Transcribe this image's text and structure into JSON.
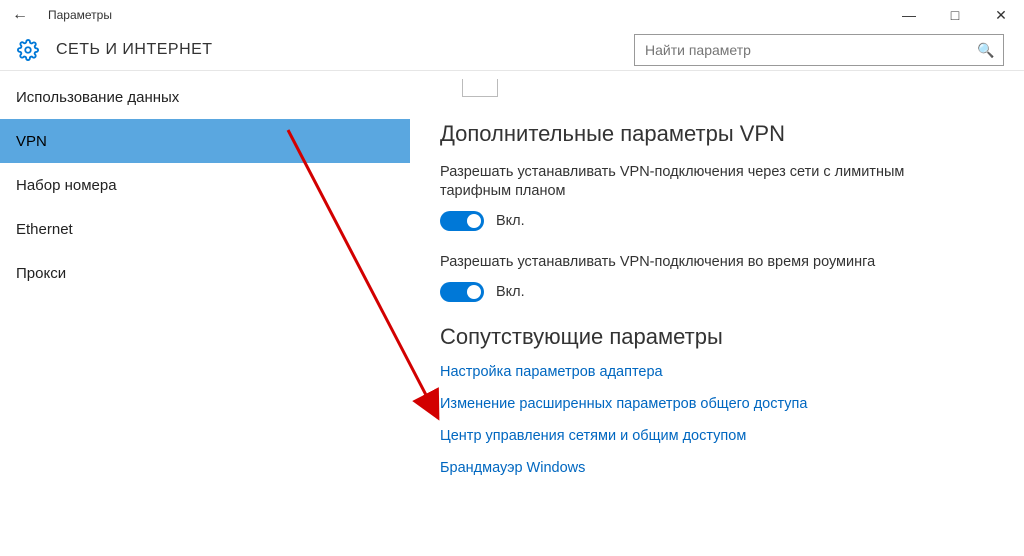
{
  "window": {
    "title": "Параметры"
  },
  "header": {
    "section_title": "СЕТЬ И ИНТЕРНЕТ",
    "search_placeholder": "Найти параметр"
  },
  "sidebar": {
    "items": [
      {
        "label": "Использование данных",
        "selected": false
      },
      {
        "label": "VPN",
        "selected": true
      },
      {
        "label": "Набор номера",
        "selected": false
      },
      {
        "label": "Ethernet",
        "selected": false
      },
      {
        "label": "Прокси",
        "selected": false
      }
    ]
  },
  "main": {
    "advanced_heading": "Дополнительные параметры VPN",
    "settings": [
      {
        "label": "Разрешать устанавливать VPN-подключения через сети с лимитным тарифным планом",
        "state": "Вкл."
      },
      {
        "label": "Разрешать устанавливать VPN-подключения во время роуминга",
        "state": "Вкл."
      }
    ],
    "related_heading": "Сопутствующие параметры",
    "links": [
      "Настройка параметров адаптера",
      "Изменение расширенных параметров общего доступа",
      "Центр управления сетями и общим доступом",
      "Брандмауэр Windows"
    ]
  }
}
